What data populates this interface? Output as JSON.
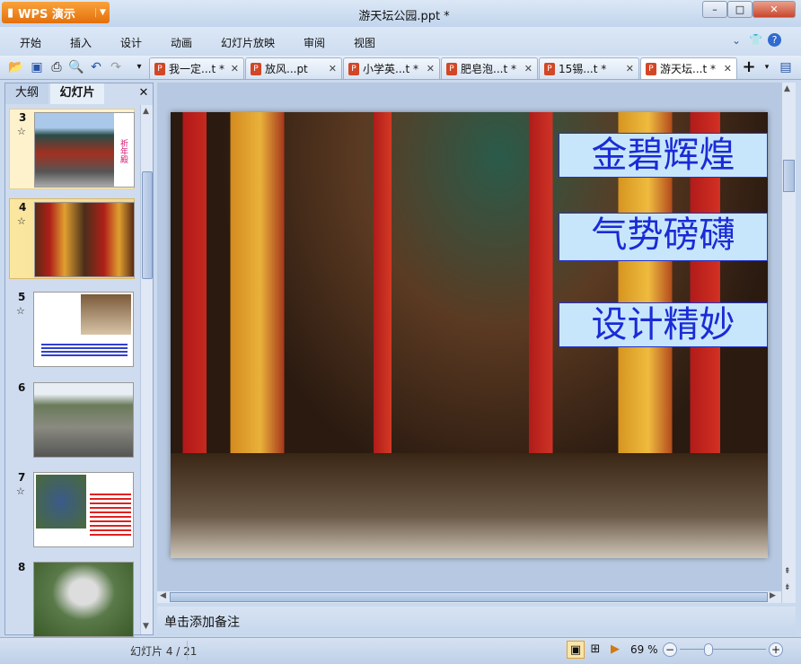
{
  "app": {
    "name": "WPS 演示",
    "title": "游天坛公园.ppt *"
  },
  "window": {
    "minimize": "–",
    "maximize": "□",
    "close": "✕"
  },
  "menu": [
    "开始",
    "插入",
    "设计",
    "动画",
    "幻灯片放映",
    "审阅",
    "视图"
  ],
  "tabs": [
    {
      "label": "我一定...t *"
    },
    {
      "label": "放风...pt"
    },
    {
      "label": "小学英...t *"
    },
    {
      "label": "肥皂泡...t *"
    },
    {
      "label": "15锡...t *"
    },
    {
      "label": "游天坛...t *",
      "active": true
    }
  ],
  "panel": {
    "tabs": [
      "大纲",
      "幻灯片"
    ],
    "close": "✕"
  },
  "thumbnails": [
    {
      "num": "3",
      "title": "祈年殿"
    },
    {
      "num": "4"
    },
    {
      "num": "5"
    },
    {
      "num": "6"
    },
    {
      "num": "7"
    },
    {
      "num": "8"
    }
  ],
  "slide": {
    "captions": [
      "金碧辉煌",
      "气势磅礴",
      "设计精妙"
    ]
  },
  "notes": {
    "placeholder": "单击添加备注"
  },
  "status": {
    "slide_indicator": "幻灯片 4 / 21",
    "zoom": "69 %",
    "zoom_value": 69
  }
}
